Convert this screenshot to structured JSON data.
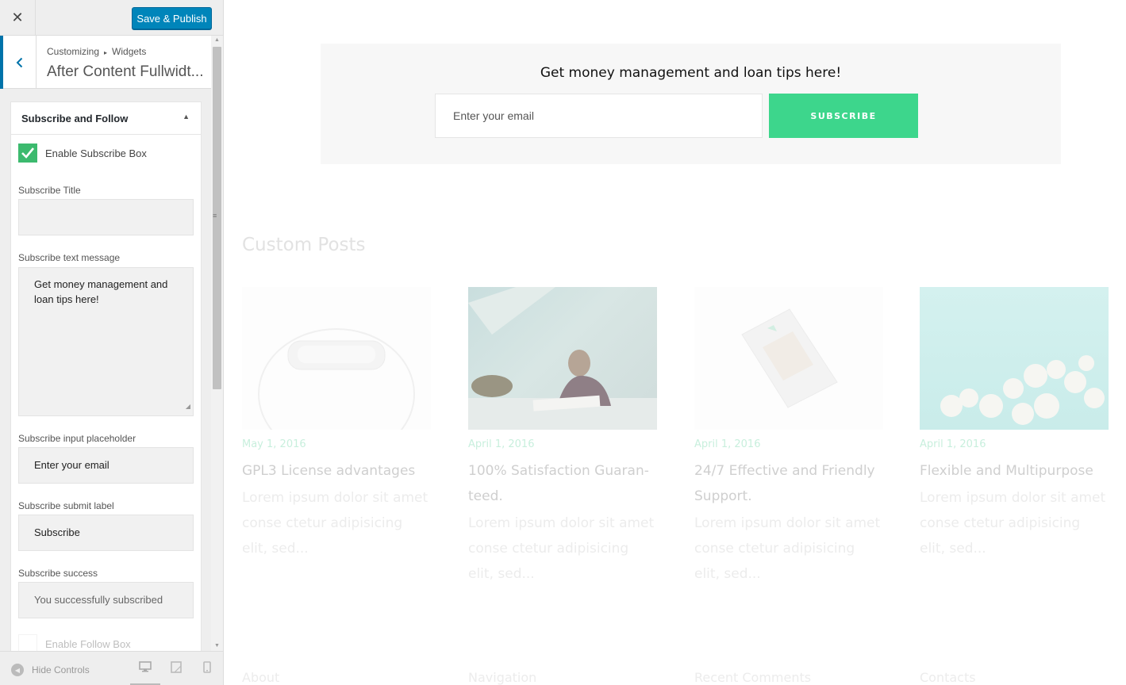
{
  "topbar": {
    "close_glyph": "✕",
    "publish_label": "Save & Publish"
  },
  "section": {
    "back_glyph": "‹",
    "breadcrumb": [
      "Customizing",
      "Widgets"
    ],
    "breadcrumb_sep": "▸",
    "title": "After Content Fullwidt..."
  },
  "widget": {
    "title": "Subscribe and Follow",
    "toggle_glyph": "▲",
    "enable_subscribe": {
      "label": "Enable Subscribe Box",
      "checked": true
    },
    "fields": {
      "title": {
        "label": "Subscribe Title",
        "value": ""
      },
      "message": {
        "label": "Subscribe text message",
        "value": "Get money management and loan tips here!"
      },
      "placeholder": {
        "label": "Subscribe input placeholder",
        "value": "Enter your email"
      },
      "submit": {
        "label": "Subscribe submit label",
        "value": "Subscribe"
      },
      "success": {
        "label": "Subscribe success",
        "value": "You successfully subscribed"
      }
    },
    "enable_follow": {
      "label": "Enable Follow Box",
      "checked": false
    }
  },
  "footer": {
    "hide_controls": "Hide Controls",
    "devices": [
      "desktop-icon",
      "tablet-icon",
      "mobile-icon"
    ]
  },
  "preview": {
    "subscribe": {
      "message": "Get money management and loan tips here!",
      "input_placeholder": "Enter your email",
      "button": "SUBSCRIBE"
    },
    "posts_heading": "Custom Posts",
    "posts": [
      {
        "date": "May 1, 2016",
        "title": "GPL3 License advantages",
        "excerpt": "Lorem ipsum dolor sit amet conse ctetur adipisicing elit, sed..."
      },
      {
        "date": "April 1, 2016",
        "title": "100% Satisfaction Guaran-teed.",
        "excerpt": "Lorem ipsum dolor sit amet conse ctetur adipisicing elit, sed..."
      },
      {
        "date": "April 1, 2016",
        "title": "24/7 Effective and Friendly Support.",
        "excerpt": "Lorem ipsum dolor sit amet conse ctetur adipisicing elit, sed..."
      },
      {
        "date": "April 1, 2016",
        "title": "Flexible and Multipurpose",
        "excerpt": "Lorem ipsum dolor sit amet conse ctetur adipisicing elit, sed..."
      }
    ],
    "footer_columns": [
      "About",
      "Navigation",
      "Recent Comments",
      "Contacts"
    ]
  },
  "colors": {
    "accent_blue": "#0085ba",
    "check_green": "#3cba6e",
    "subscribe_green": "#3dd68c"
  }
}
